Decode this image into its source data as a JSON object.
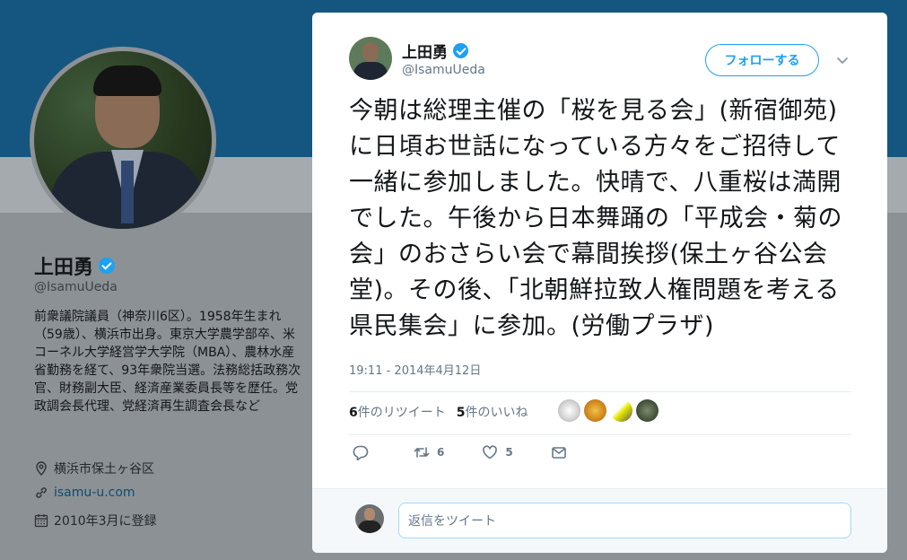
{
  "profile": {
    "name": "上田勇",
    "handle": "@IsamuUeda",
    "bio": "前衆議院議員（神奈川6区）。1958年生まれ（59歳）、横浜市出身。東京大学農学部卒、米コーネル大学経営学大学院（MBA）、農林水産省勤務を経て、93年衆院当選。法務総括政務次官、財務副大臣、経済産業委員長等を歴任。党政調会長代理、党経済再生調査会長など",
    "location": "横浜市保土ヶ谷区",
    "url": "isamu-u.com",
    "joined": "2010年3月に登録"
  },
  "tweet": {
    "author_name": "上田勇",
    "author_handle": "@IsamuUeda",
    "follow_label": "フォローする",
    "text": "今朝は総理主催の「桜を見る会」(新宿御苑)に日頃お世話になっている方々をご招待して一緒に参加しました。快晴で、八重桜は満開でした。午後から日本舞踊の「平成会・菊の会」のおさらい会で幕間挨拶(保土ヶ谷公会堂)。その後、「北朝鮮拉致人権問題を考える県民集会」に参加。(労働プラザ)",
    "timestamp": "19:11 - 2014年4月12日",
    "retweet_count": "6",
    "retweet_label": "件のリツイート",
    "like_count": "5",
    "like_label": "件のいいね",
    "actions": {
      "reply_count": "",
      "retweet_count": "6",
      "like_count": "5"
    },
    "reply_placeholder": "返信をツイート"
  },
  "colors": {
    "accent": "#1da1f2",
    "banner": "#14567f",
    "text": "#14171a",
    "muted": "#657786"
  },
  "likers": [
    "liker-1",
    "liker-2",
    "liker-3",
    "liker-4"
  ]
}
